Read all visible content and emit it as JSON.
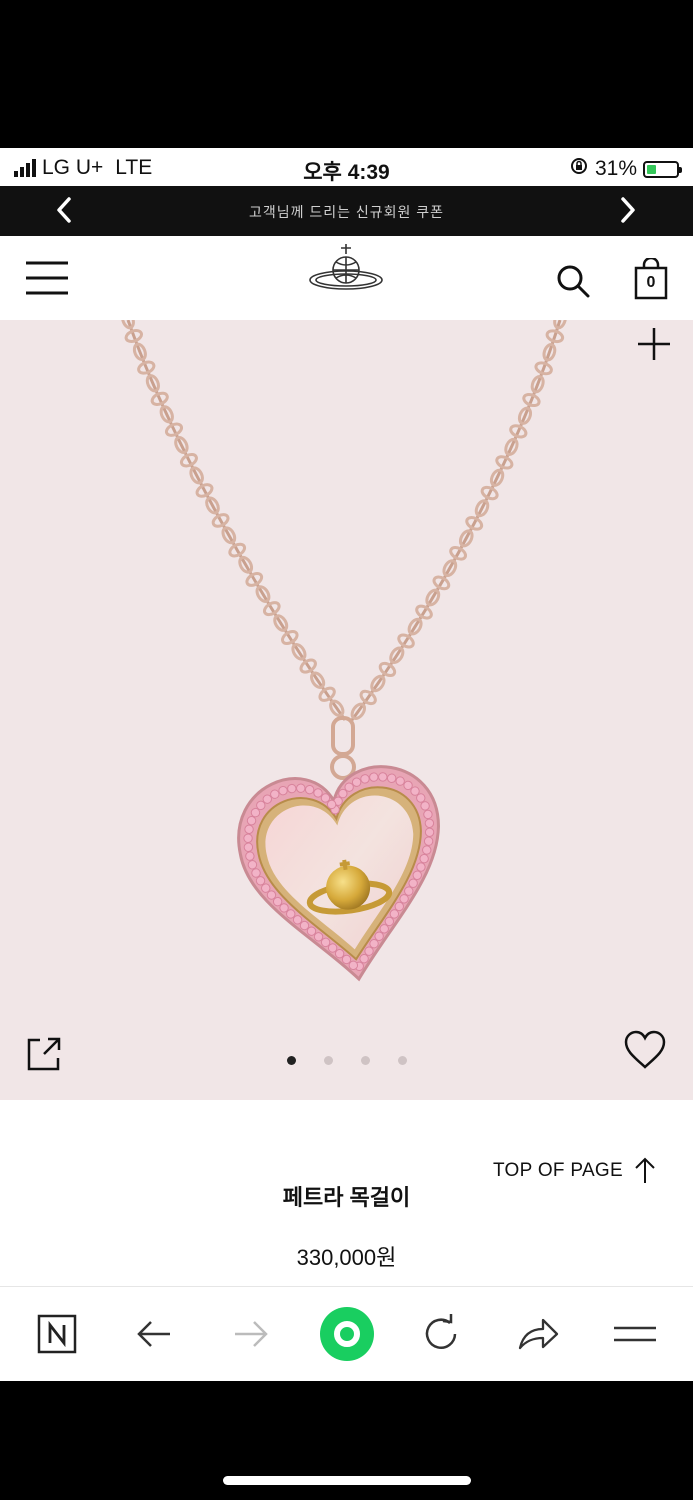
{
  "status": {
    "carrier": "LG U+",
    "network": "LTE",
    "time": "오후 4:39",
    "battery": "31%",
    "battery_level": 0.31
  },
  "announcement": {
    "text": "고객님께 드리는 신규회원 쿠폰"
  },
  "header": {
    "logo": "orb-logo",
    "cart_count": "0"
  },
  "gallery": {
    "image": "heart-pendant-necklace",
    "slide_count": 4,
    "active_slide": 1
  },
  "product": {
    "name": "페트라 목걸이",
    "price": "330,000원",
    "top_of_page": "TOP OF PAGE"
  },
  "colors": {
    "background": "#f1e6e7",
    "accent_green": "#19ce60",
    "text": "#111111"
  },
  "toolbar": {
    "items": [
      "naver-icon",
      "back-icon",
      "forward-icon",
      "home-icon",
      "reload-icon",
      "share-icon",
      "menu-icon"
    ]
  }
}
